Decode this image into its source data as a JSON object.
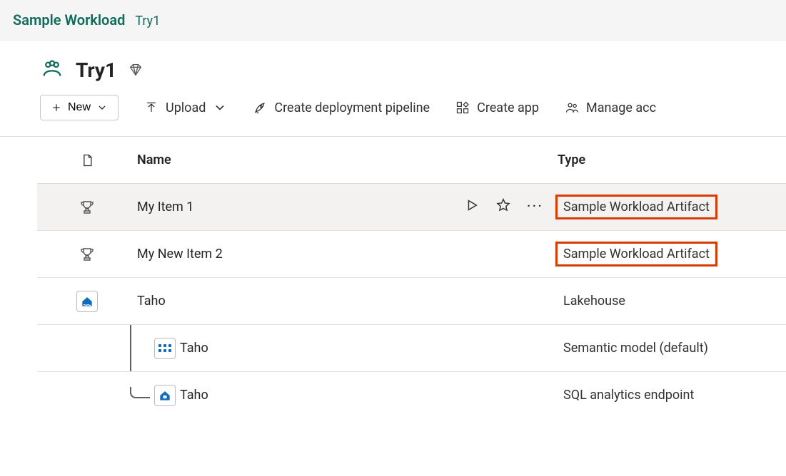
{
  "breadcrumb": {
    "app": "Sample Workload",
    "workspace": "Try1"
  },
  "workspace": {
    "name": "Try1"
  },
  "toolbar": {
    "newLabel": "New",
    "uploadLabel": "Upload",
    "pipelineLabel": "Create deployment pipeline",
    "createAppLabel": "Create app",
    "manageAccessLabel": "Manage acc"
  },
  "columns": {
    "name": "Name",
    "type": "Type"
  },
  "items": [
    {
      "icon": "trophy",
      "name": "My Item 1",
      "type": "Sample Workload Artifact",
      "highlight": true,
      "hovered": true,
      "children": []
    },
    {
      "icon": "trophy",
      "name": "My New Item 2",
      "type": "Sample Workload Artifact",
      "highlight": true,
      "hovered": false,
      "children": []
    },
    {
      "icon": "lakehouse",
      "name": "Taho",
      "type": "Lakehouse",
      "highlight": false,
      "hovered": false,
      "children": [
        {
          "icon": "semantic",
          "name": "Taho",
          "type": "Semantic model (default)"
        },
        {
          "icon": "sql",
          "name": "Taho",
          "type": "SQL analytics endpoint"
        }
      ]
    }
  ]
}
